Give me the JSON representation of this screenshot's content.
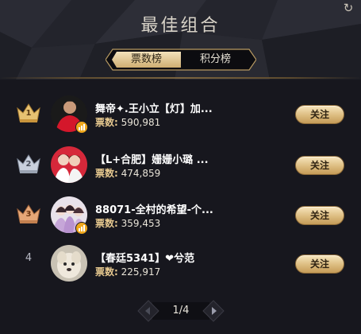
{
  "header": {
    "title": "最佳组合",
    "refresh_icon": "refresh-icon"
  },
  "tabs": [
    {
      "label": "票数榜",
      "active": true
    },
    {
      "label": "积分榜",
      "active": false
    }
  ],
  "list": {
    "votes_label": "票数:",
    "follow_label": "关注",
    "items": [
      {
        "rank": "1",
        "rank_style": "gold-crown",
        "name": "舞帝✦.王小立【灯】加...",
        "votes": "590,981",
        "live_badge": true
      },
      {
        "rank": "2",
        "rank_style": "silver-crown",
        "name": "【L+合肥】姗姗小璐 ...",
        "votes": "474,859",
        "live_badge": false
      },
      {
        "rank": "3",
        "rank_style": "bronze-crown",
        "name": "88071-全村的希望-个...",
        "votes": "359,453",
        "live_badge": true
      },
      {
        "rank": "4",
        "rank_style": "plain",
        "name": "【春廷5341】❤兮范",
        "votes": "225,917",
        "live_badge": false
      }
    ]
  },
  "pager": {
    "text": "1/4"
  },
  "colors": {
    "gold": "#dcbc80",
    "background": "#17171e",
    "badge": "#f0a81c"
  }
}
